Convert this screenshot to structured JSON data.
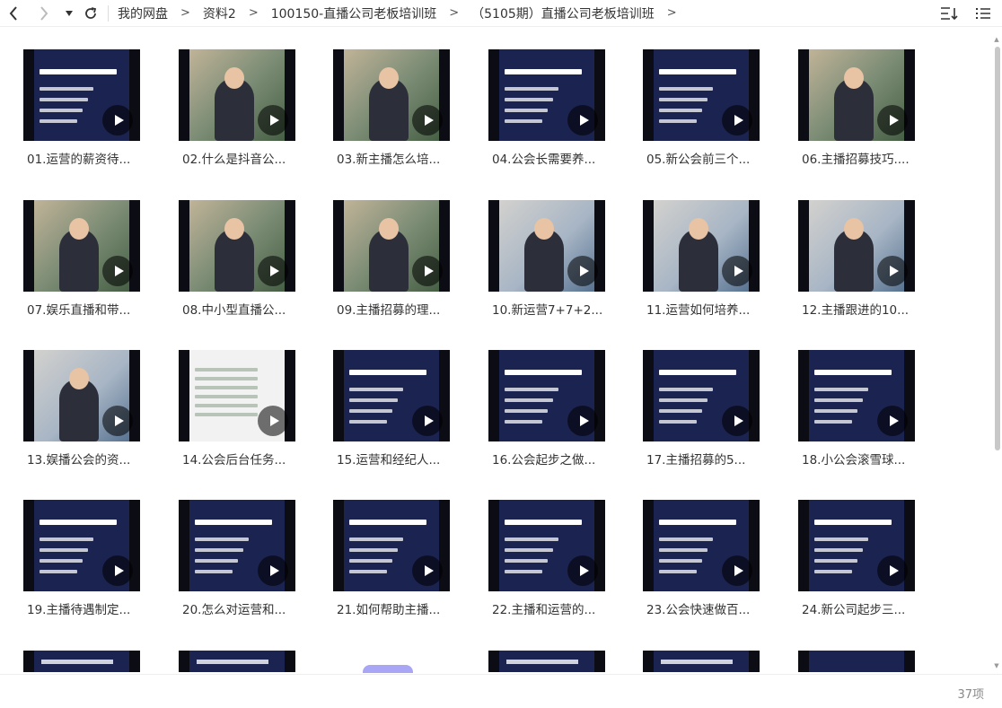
{
  "toolbar": {
    "back_icon": "chevron-left-icon",
    "forward_icon": "chevron-right-icon",
    "dropdown_icon": "caret-down-icon",
    "refresh_icon": "refresh-icon",
    "sort_icon": "sort-icon",
    "view_icon": "list-view-icon"
  },
  "breadcrumb": [
    "我的网盘",
    "资料2",
    "100150-直播公司老板培训班",
    "（5105期）直播公司老板培训班"
  ],
  "breadcrumb_sep": ">",
  "files": [
    "01.运营的薪资待...",
    "02.什么是抖音公...",
    "03.新主播怎么培...",
    "04.公会长需要养...",
    "05.新公会前三个...",
    "06.主播招募技巧....",
    "07.娱乐直播和带...",
    "08.中小型直播公...",
    "09.主播招募的理...",
    "10.新运营7+7+2...",
    "11.运营如何培养...",
    "12.主播跟进的10...",
    "13.娱播公会的资...",
    "14.公会后台任务...",
    "15.运营和经纪人...",
    "16.公会起步之做...",
    "17.主播招募的5...",
    "18.小公会滚雪球...",
    "19.主播待遇制定...",
    "20.怎么对运营和...",
    "21.如何帮助主播...",
    "22.主播和运营的...",
    "23.公会快速做百...",
    "24.新公司起步三..."
  ],
  "status": {
    "count": "37项"
  },
  "colors": {
    "thumb_bg": "#1b2350",
    "play_overlay": "#000000"
  }
}
